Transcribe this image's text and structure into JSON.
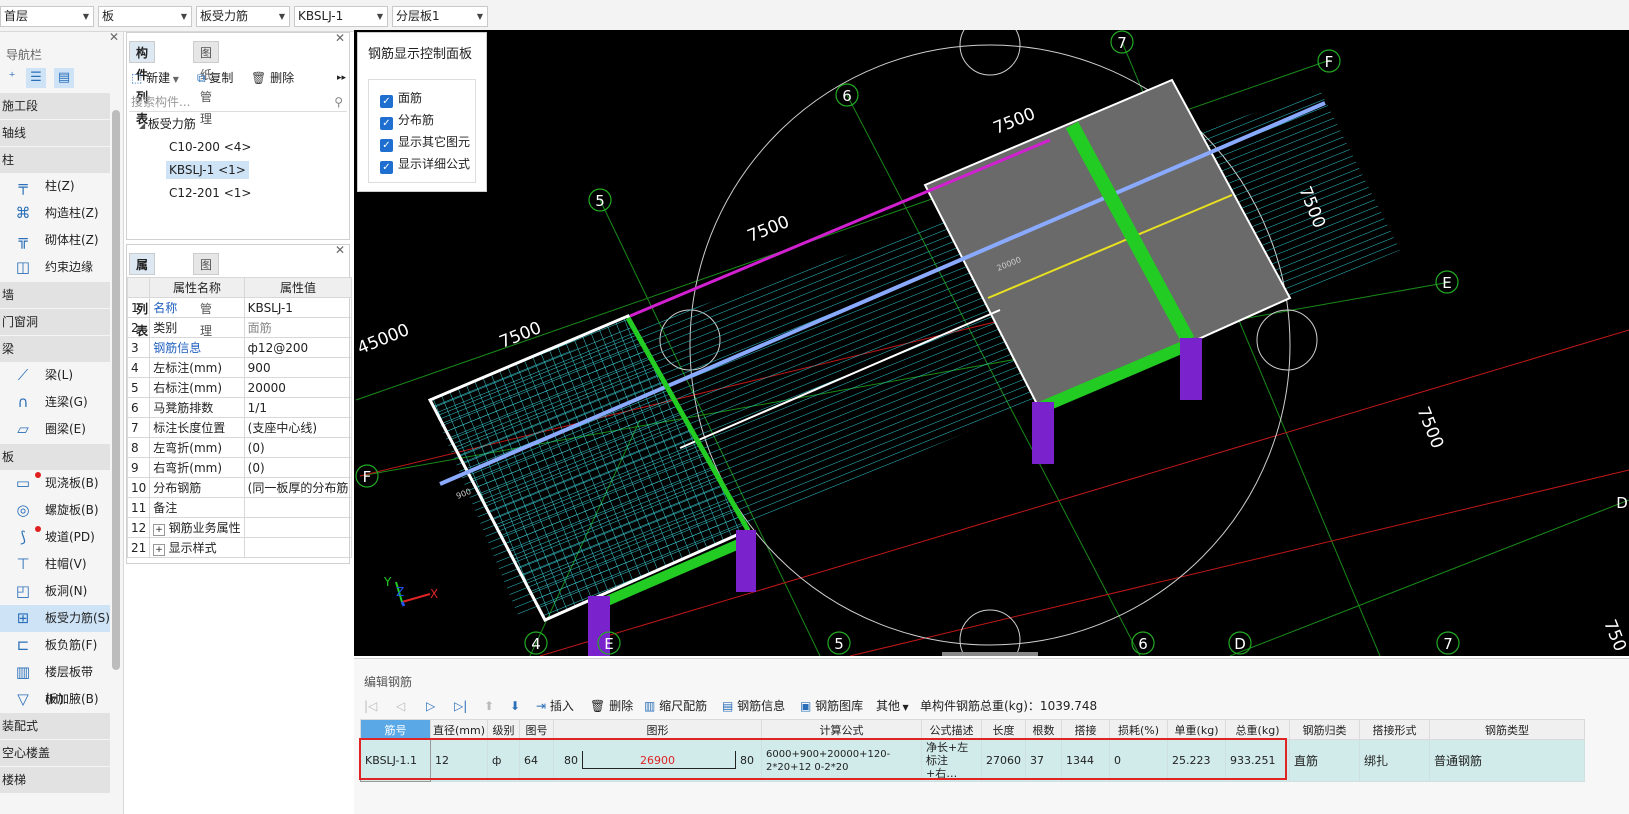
{
  "topbar": {
    "floor": "首层",
    "category": "板",
    "type": "板受力筋",
    "component": "KBSLJ-1",
    "layer": "分层板1"
  },
  "nav": {
    "title": "导航栏",
    "sections": [
      {
        "label": "施工段"
      },
      {
        "label": "轴线"
      },
      {
        "label": "柱"
      },
      {
        "label": "墙"
      },
      {
        "label": "门窗洞"
      },
      {
        "label": "梁"
      },
      {
        "label": "板"
      },
      {
        "label": "装配式"
      },
      {
        "label": "空心楼盖"
      },
      {
        "label": "楼梯"
      }
    ],
    "items": [
      {
        "label": "柱(Z)",
        "icon": "column-icon"
      },
      {
        "label": "构造柱(Z)",
        "icon": "constructional-column-icon"
      },
      {
        "label": "砌体柱(Z)",
        "icon": "masonry-column-icon"
      },
      {
        "label": "约束边缘非...",
        "icon": "boundary-column-icon"
      },
      {
        "label": "梁(L)",
        "icon": "beam-icon"
      },
      {
        "label": "连梁(G)",
        "icon": "coupling-beam-icon"
      },
      {
        "label": "圈梁(E)",
        "icon": "ring-beam-icon"
      },
      {
        "label": "现浇板(B)",
        "icon": "cast-slab-icon"
      },
      {
        "label": "螺旋板(B)",
        "icon": "spiral-slab-icon"
      },
      {
        "label": "坡道(PD)",
        "icon": "ramp-icon"
      },
      {
        "label": "柱帽(V)",
        "icon": "column-cap-icon"
      },
      {
        "label": "板洞(N)",
        "icon": "slab-hole-icon"
      },
      {
        "label": "板受力筋(S)",
        "icon": "slab-rebar-icon"
      },
      {
        "label": "板负筋(F)",
        "icon": "negative-rebar-icon"
      },
      {
        "label": "楼层板带(H)",
        "icon": "slab-strip-icon"
      },
      {
        "label": "板加腋(B)",
        "icon": "slab-haunch-icon"
      }
    ]
  },
  "component_panel": {
    "tab_list": "构件列表",
    "tab_drawings": "图纸管理",
    "new_label": "新建",
    "copy_label": "复制",
    "delete_label": "删除",
    "search_placeholder": "搜索构件...",
    "tree_root": "板受力筋",
    "tree_items": [
      "C10-200 <4>",
      "KBSLJ-1 <1>",
      "C12-201 <1>"
    ]
  },
  "property_panel": {
    "tab_props": "属性列表",
    "tab_layers": "图层管理",
    "col_name": "属性名称",
    "col_value": "属性值",
    "rows": [
      {
        "no": "1",
        "name": "名称",
        "value": "KBSLJ-1"
      },
      {
        "no": "2",
        "name": "类别",
        "value": "面筋"
      },
      {
        "no": "3",
        "name": "钢筋信息",
        "value": "ф12@200"
      },
      {
        "no": "4",
        "name": "左标注(mm)",
        "value": "900"
      },
      {
        "no": "5",
        "name": "右标注(mm)",
        "value": "20000"
      },
      {
        "no": "6",
        "name": "马凳筋排数",
        "value": "1/1"
      },
      {
        "no": "7",
        "name": "标注长度位置",
        "value": "(支座中心线)"
      },
      {
        "no": "8",
        "name": "左弯折(mm)",
        "value": "(0)"
      },
      {
        "no": "9",
        "name": "右弯折(mm)",
        "value": "(0)"
      },
      {
        "no": "10",
        "name": "分布钢筋",
        "value": "(同一板厚的分布筋"
      },
      {
        "no": "11",
        "name": "备注",
        "value": ""
      },
      {
        "no": "12",
        "name": "钢筋业务属性",
        "value": ""
      },
      {
        "no": "21",
        "name": "显示样式",
        "value": ""
      }
    ]
  },
  "control_panel": {
    "title": "钢筋显示控制面板",
    "options": [
      "面筋",
      "分布筋",
      "显示其它图元",
      "显示详细公式"
    ]
  },
  "viewport": {
    "axis_labels": [
      "7",
      "F",
      "6",
      "5",
      "E",
      "4",
      "E",
      "5",
      "6",
      "D",
      "7",
      "F",
      "D"
    ],
    "dims": [
      "7500",
      "7500",
      "7500",
      "7500",
      "7500",
      "45000",
      "750"
    ],
    "small_labels": [
      "20000",
      "900"
    ],
    "axes": {
      "x": "X",
      "y": "Y",
      "z": "Z"
    },
    "colors": {
      "green": "#22cc22",
      "purple": "#7a22cc",
      "cyan": "#33cccc",
      "magenta": "#cc22cc",
      "yellow": "#e8e020",
      "blue": "#88aaff"
    }
  },
  "edit_rebar": {
    "title": "编辑钢筋",
    "tools": [
      "插入",
      "删除",
      "缩尺配筋",
      "钢筋信息",
      "钢筋图库",
      "其他"
    ],
    "total_weight_label": "单构件钢筋总重(kg)：1039.748",
    "headers": [
      "筋号",
      "直径(mm)",
      "级别",
      "图号",
      "图形",
      "计算公式",
      "公式描述",
      "长度",
      "根数",
      "搭接",
      "损耗(%)",
      "单重(kg)",
      "总重(kg)",
      "钢筋归类",
      "搭接形式",
      "钢筋类型"
    ],
    "row": {
      "bar_no": "KBSLJ-1.1",
      "diameter": "12",
      "grade": "ф",
      "shape_no": "64",
      "left_hook": "80",
      "shape_len": "26900",
      "right_hook": "80",
      "formula": "6000+900+20000+120-2*20+12 0-2*20",
      "desc": "净长+左标注+右…",
      "length": "27060",
      "count": "37",
      "lap": "1344",
      "loss": "0",
      "unit_weight": "25.223",
      "total_weight": "933.251",
      "category": "直筋",
      "lap_form": "绑扎",
      "rebar_type": "普通钢筋"
    }
  }
}
